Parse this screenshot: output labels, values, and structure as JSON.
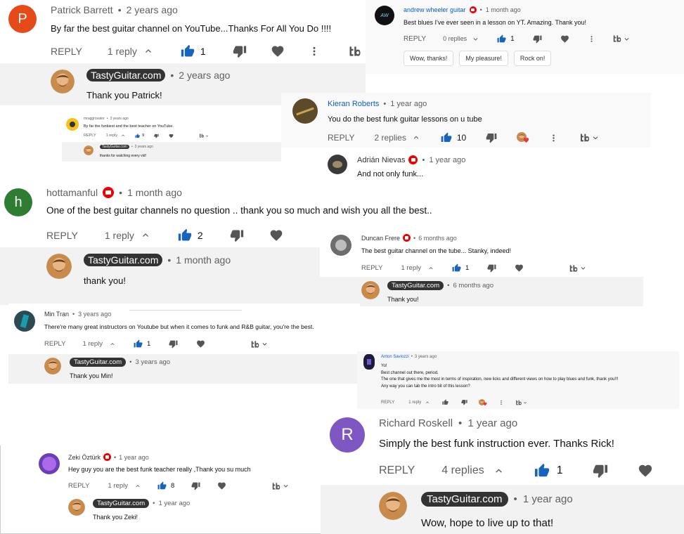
{
  "colors": {
    "reply_bg": "#f2f2f2",
    "like_blue": "#1565c0",
    "link_blue": "#065fd4",
    "creator_pill": "#333333",
    "member_badge": "#e00000"
  },
  "c1": {
    "avatar_letter": "P",
    "avatar_color": "#e64a19",
    "author": "Patrick Barrett",
    "time": "2 years ago",
    "text": "By far the best guitar channel on YouTube...Thanks For All You Do !!!!",
    "reply": "REPLY",
    "replies": "1 reply",
    "likes": "1"
  },
  "c1r": {
    "author": "TastyGuitar.com",
    "time": "2 years ago",
    "text": "Thank you Patrick!"
  },
  "c2": {
    "author": "andrew wheeler guitar",
    "time": "1 month ago",
    "text": "Best blues I've ever seen in a lesson on YT. Amazing. Thank you!",
    "reply": "REPLY",
    "replies": "0 replies",
    "likes": "1",
    "chips": [
      "Wow, thanks!",
      "My pleasure!",
      "Rock on!"
    ]
  },
  "c3": {
    "author": "mraggrovator",
    "time": "3 years ago",
    "text": "By far the funkiest and the best teacher on YouTube.",
    "reply": "REPLY",
    "replies": "1 reply",
    "likes": "9"
  },
  "c3r": {
    "author": "TastyGuitar.com",
    "time": "3 years ago",
    "text": "thanks for watching every vid!"
  },
  "c4": {
    "author": "Kieran Roberts",
    "time": "1 year ago",
    "text": "You do the best funk guitar lessons on u tube",
    "reply": "REPLY",
    "replies": "2 replies",
    "likes": "10"
  },
  "c4r": {
    "author": "Adrián Nievas",
    "time": "1 year ago",
    "text": "And not only funk..."
  },
  "c5": {
    "avatar_letter": "h",
    "avatar_color": "#2e7d32",
    "author": "hottamanful",
    "time": "1 month ago",
    "text": "One of the best guitar channels no question .. thank you so much and wish you all the best..",
    "reply": "REPLY",
    "replies": "1 reply",
    "likes": "2"
  },
  "c5r": {
    "author": "TastyGuitar.com",
    "time": "1 month ago",
    "text": "thank you!"
  },
  "c6": {
    "author": "Duncan Frere",
    "time": "6 months ago",
    "text": "The best guitar channel on the tube... Stanky, indeed!",
    "reply": "REPLY",
    "replies": "1 reply",
    "likes": "1"
  },
  "c6r": {
    "author": "TastyGuitar.com",
    "time": "6 months ago",
    "text": "Thank you!"
  },
  "c7": {
    "author": "Min Tran",
    "time": "3 years ago",
    "text": "There're many great instructors on Youtube but when it comes to funk and R&B guitar, you're the best.",
    "reply": "REPLY",
    "replies": "1 reply",
    "likes": "1"
  },
  "c7r": {
    "author": "TastyGuitar.com",
    "time": "3 years ago",
    "text": "Thank you Min!"
  },
  "c8": {
    "author": "Anton Saviozzi",
    "time": "3 years ago",
    "lines": [
      "Yo!",
      "Best channel out there, period.",
      "The one that gives me the most in terms of inspiration, new licks and different views on how to play blues and funk, thank you!!!",
      "Any way you can tab the intro bit of this lesson?"
    ],
    "reply": "REPLY",
    "replies": "1 reply"
  },
  "c9": {
    "avatar_letter": "R",
    "avatar_color": "#7e57c2",
    "author": "Richard Roskell",
    "time": "1 year ago",
    "text": "Simply the best funk instruction ever. Thanks Rick!",
    "reply": "REPLY",
    "replies": "4 replies",
    "likes": "1"
  },
  "c9r": {
    "author": "TastyGuitar.com",
    "time": "1 year ago",
    "text": "Wow, hope to live up to that!"
  },
  "c10": {
    "author": "Zeki Öztürk",
    "time": "1 year ago",
    "text": "Hey guy you are the best funk teacher really ,Thank you su much",
    "reply": "REPLY",
    "replies": "1 reply",
    "likes": "8"
  },
  "c10r": {
    "author": "TastyGuitar.com",
    "time": "1 year ago",
    "text": "Thank you Zeki!"
  },
  "sep": "•"
}
